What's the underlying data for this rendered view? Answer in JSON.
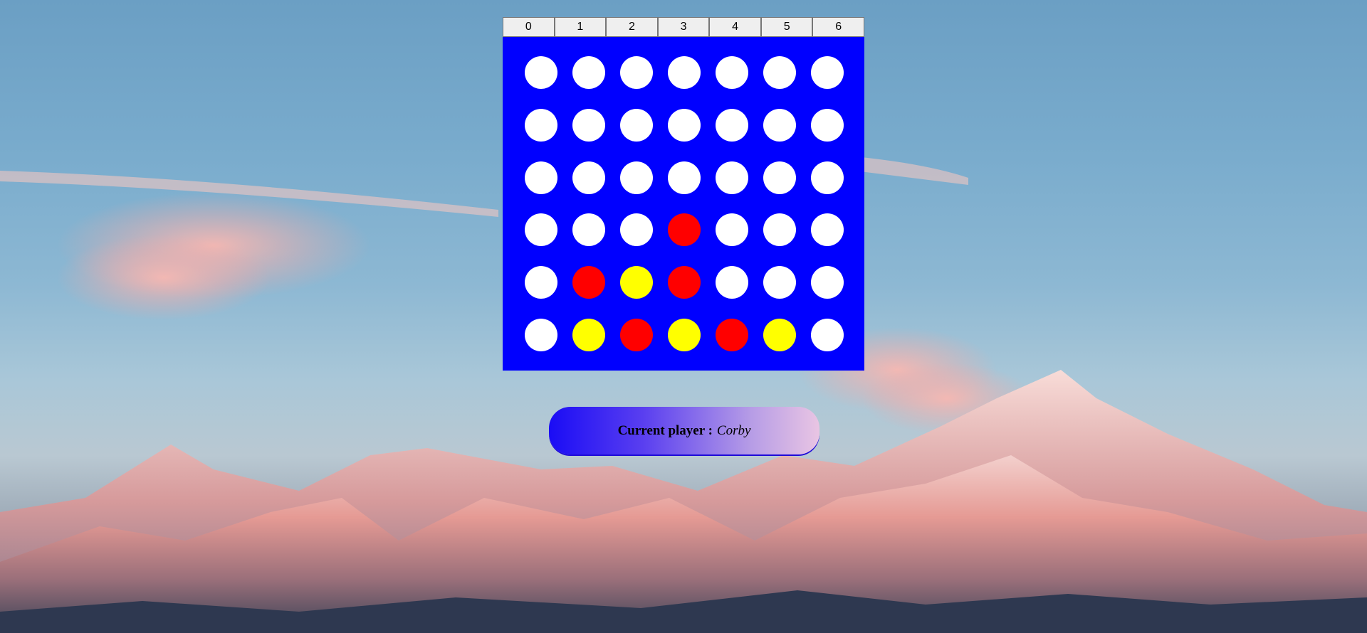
{
  "column_buttons": [
    "0",
    "1",
    "2",
    "3",
    "4",
    "5",
    "6"
  ],
  "board": {
    "rows": 6,
    "cols": 7,
    "cells": [
      [
        "empty",
        "empty",
        "empty",
        "empty",
        "empty",
        "empty",
        "empty"
      ],
      [
        "empty",
        "empty",
        "empty",
        "empty",
        "empty",
        "empty",
        "empty"
      ],
      [
        "empty",
        "empty",
        "empty",
        "empty",
        "empty",
        "empty",
        "empty"
      ],
      [
        "empty",
        "empty",
        "empty",
        "red",
        "empty",
        "empty",
        "empty"
      ],
      [
        "empty",
        "red",
        "yellow",
        "red",
        "empty",
        "empty",
        "empty"
      ],
      [
        "empty",
        "yellow",
        "red",
        "yellow",
        "red",
        "yellow",
        "empty"
      ]
    ]
  },
  "colors": {
    "board": "#0000ff",
    "empty": "#ffffff",
    "red": "#ff0000",
    "yellow": "#ffff00"
  },
  "status": {
    "label": "Current player :",
    "player": "Corby"
  }
}
